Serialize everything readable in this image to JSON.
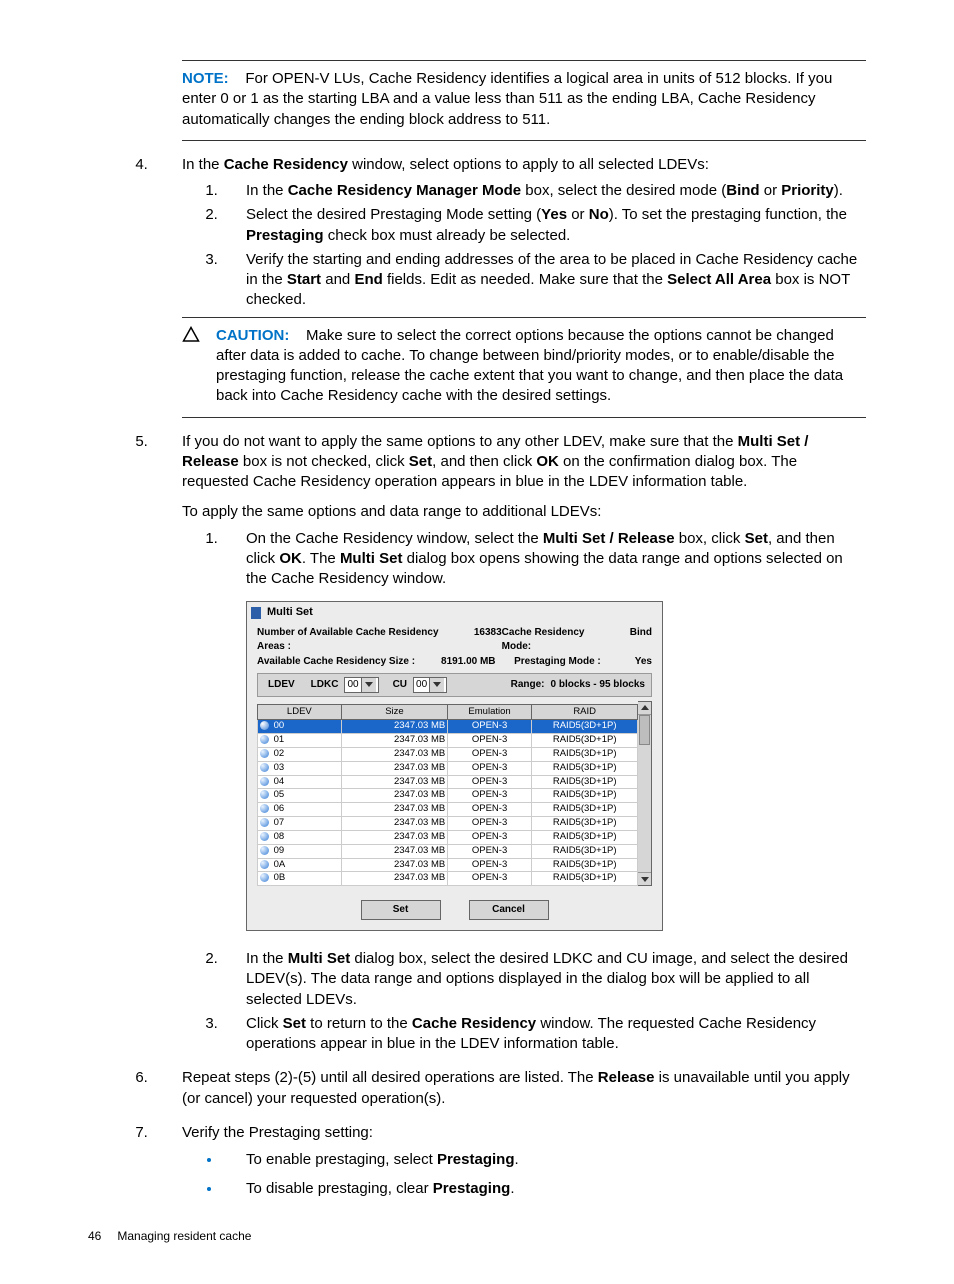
{
  "note": {
    "label": "NOTE:",
    "text": "For OPEN-V LUs, Cache Residency identifies a logical area in units of 512 blocks. If you enter 0 or 1 as the starting LBA and a value less than 511 as the ending LBA, Cache Residency automatically changes the ending block address to 511."
  },
  "step4": {
    "intro_a": "In the ",
    "intro_b": "Cache Residency",
    "intro_c": " window, select options to apply to all selected LDEVs:",
    "s1a": "In the ",
    "s1b": "Cache Residency Manager Mode",
    "s1c": " box, select the desired mode (",
    "s1d": "Bind",
    "s1e": " or ",
    "s1f": "Priority",
    "s1g": ").",
    "s2a": "Select the desired Prestaging Mode setting (",
    "s2b": "Yes",
    "s2c": " or ",
    "s2d": "No",
    "s2e": "). To set the prestaging function, the ",
    "s2f": "Prestaging",
    "s2g": " check box must already be selected.",
    "s3a": "Verify the starting and ending addresses of the area to be placed in Cache Residency cache in the ",
    "s3b": "Start",
    "s3c": " and ",
    "s3d": "End",
    "s3e": " fields. Edit as needed. Make sure that the ",
    "s3f": "Select All Area",
    "s3g": " box is NOT checked."
  },
  "caution": {
    "label": "CAUTION:",
    "text": "Make sure to select the correct options because the options cannot be changed after data is added to cache. To change between bind/priority modes, or to enable/disable the prestaging function, release the cache extent that you want to change, and then place the data back into Cache Residency cache with the desired settings."
  },
  "step5": {
    "p1a": "If you do not want to apply the same options to any other LDEV, make sure that the ",
    "p1b": "Multi Set / Release",
    "p1c": " box is not checked, click ",
    "p1d": "Set",
    "p1e": ", and then click ",
    "p1f": "OK",
    "p1g": " on the confirmation dialog box. The requested Cache Residency operation appears in blue in the LDEV information table.",
    "p2": "To apply the same options and data range to additional LDEVs:",
    "s1a": "On the Cache Residency window, select the ",
    "s1b": "Multi Set / Release",
    "s1c": " box, click ",
    "s1d": "Set",
    "s1e": ", and then click ",
    "s1f": "OK",
    "s1g": ". The ",
    "s1h": "Multi Set",
    "s1i": " dialog box opens showing the data range and options selected on the Cache Residency window.",
    "s2a": "In the ",
    "s2b": "Multi Set",
    "s2c": " dialog box, select the desired LDKC and CU image, and select the desired LDEV(s). The data range and options displayed in the dialog box will be applied to all selected LDEVs.",
    "s3a": "Click ",
    "s3b": "Set",
    "s3c": " to return to the ",
    "s3d": "Cache Residency",
    "s3e": " window. The requested Cache Residency operations appear in blue in the LDEV information table."
  },
  "step6": {
    "a": "Repeat steps (2)-(5) until all desired operations are listed. The ",
    "b": "Release",
    "c": " is unavailable until you apply (or cancel) your requested operation(s)."
  },
  "step7": {
    "intro": "Verify the Prestaging setting:",
    "b1a": "To enable prestaging, select ",
    "b1b": "Prestaging",
    "b1c": ".",
    "b2a": "To disable prestaging, clear ",
    "b2b": "Prestaging",
    "b2c": "."
  },
  "screenshot": {
    "title": "Multi Set",
    "left_labels": {
      "areas": "Number of Available Cache Residency Areas :",
      "areas_val": "16383",
      "size": "Available Cache Residency Size :",
      "size_val": "8191.00 MB"
    },
    "right_labels": {
      "mode": "Cache Residency Mode:",
      "mode_val": "Bind",
      "prestage": "Prestaging Mode  :",
      "prestage_val": "Yes"
    },
    "ldev_bar": {
      "ldev": "LDEV",
      "ldkc": "LDKC",
      "ldkc_val": "00",
      "cu": "CU",
      "cu_val": "00",
      "range": "Range:",
      "range_val": "0 blocks - 95 blocks"
    },
    "headers": {
      "c1": "LDEV",
      "c2": "Size",
      "c3": "Emulation",
      "c4": "RAID"
    },
    "rows": [
      {
        "id": "00",
        "size": "2347.03 MB",
        "emu": "OPEN-3",
        "raid": "RAID5(3D+1P)",
        "sel": true
      },
      {
        "id": "01",
        "size": "2347.03 MB",
        "emu": "OPEN-3",
        "raid": "RAID5(3D+1P)"
      },
      {
        "id": "02",
        "size": "2347.03 MB",
        "emu": "OPEN-3",
        "raid": "RAID5(3D+1P)"
      },
      {
        "id": "03",
        "size": "2347.03 MB",
        "emu": "OPEN-3",
        "raid": "RAID5(3D+1P)"
      },
      {
        "id": "04",
        "size": "2347.03 MB",
        "emu": "OPEN-3",
        "raid": "RAID5(3D+1P)"
      },
      {
        "id": "05",
        "size": "2347.03 MB",
        "emu": "OPEN-3",
        "raid": "RAID5(3D+1P)"
      },
      {
        "id": "06",
        "size": "2347.03 MB",
        "emu": "OPEN-3",
        "raid": "RAID5(3D+1P)"
      },
      {
        "id": "07",
        "size": "2347.03 MB",
        "emu": "OPEN-3",
        "raid": "RAID5(3D+1P)"
      },
      {
        "id": "08",
        "size": "2347.03 MB",
        "emu": "OPEN-3",
        "raid": "RAID5(3D+1P)"
      },
      {
        "id": "09",
        "size": "2347.03 MB",
        "emu": "OPEN-3",
        "raid": "RAID5(3D+1P)"
      },
      {
        "id": "0A",
        "size": "2347.03 MB",
        "emu": "OPEN-3",
        "raid": "RAID5(3D+1P)"
      },
      {
        "id": "0B",
        "size": "2347.03 MB",
        "emu": "OPEN-3",
        "raid": "RAID5(3D+1P)"
      }
    ],
    "buttons": {
      "set": "Set",
      "cancel": "Cancel"
    }
  },
  "footer": {
    "page": "46",
    "title": "Managing resident cache"
  }
}
